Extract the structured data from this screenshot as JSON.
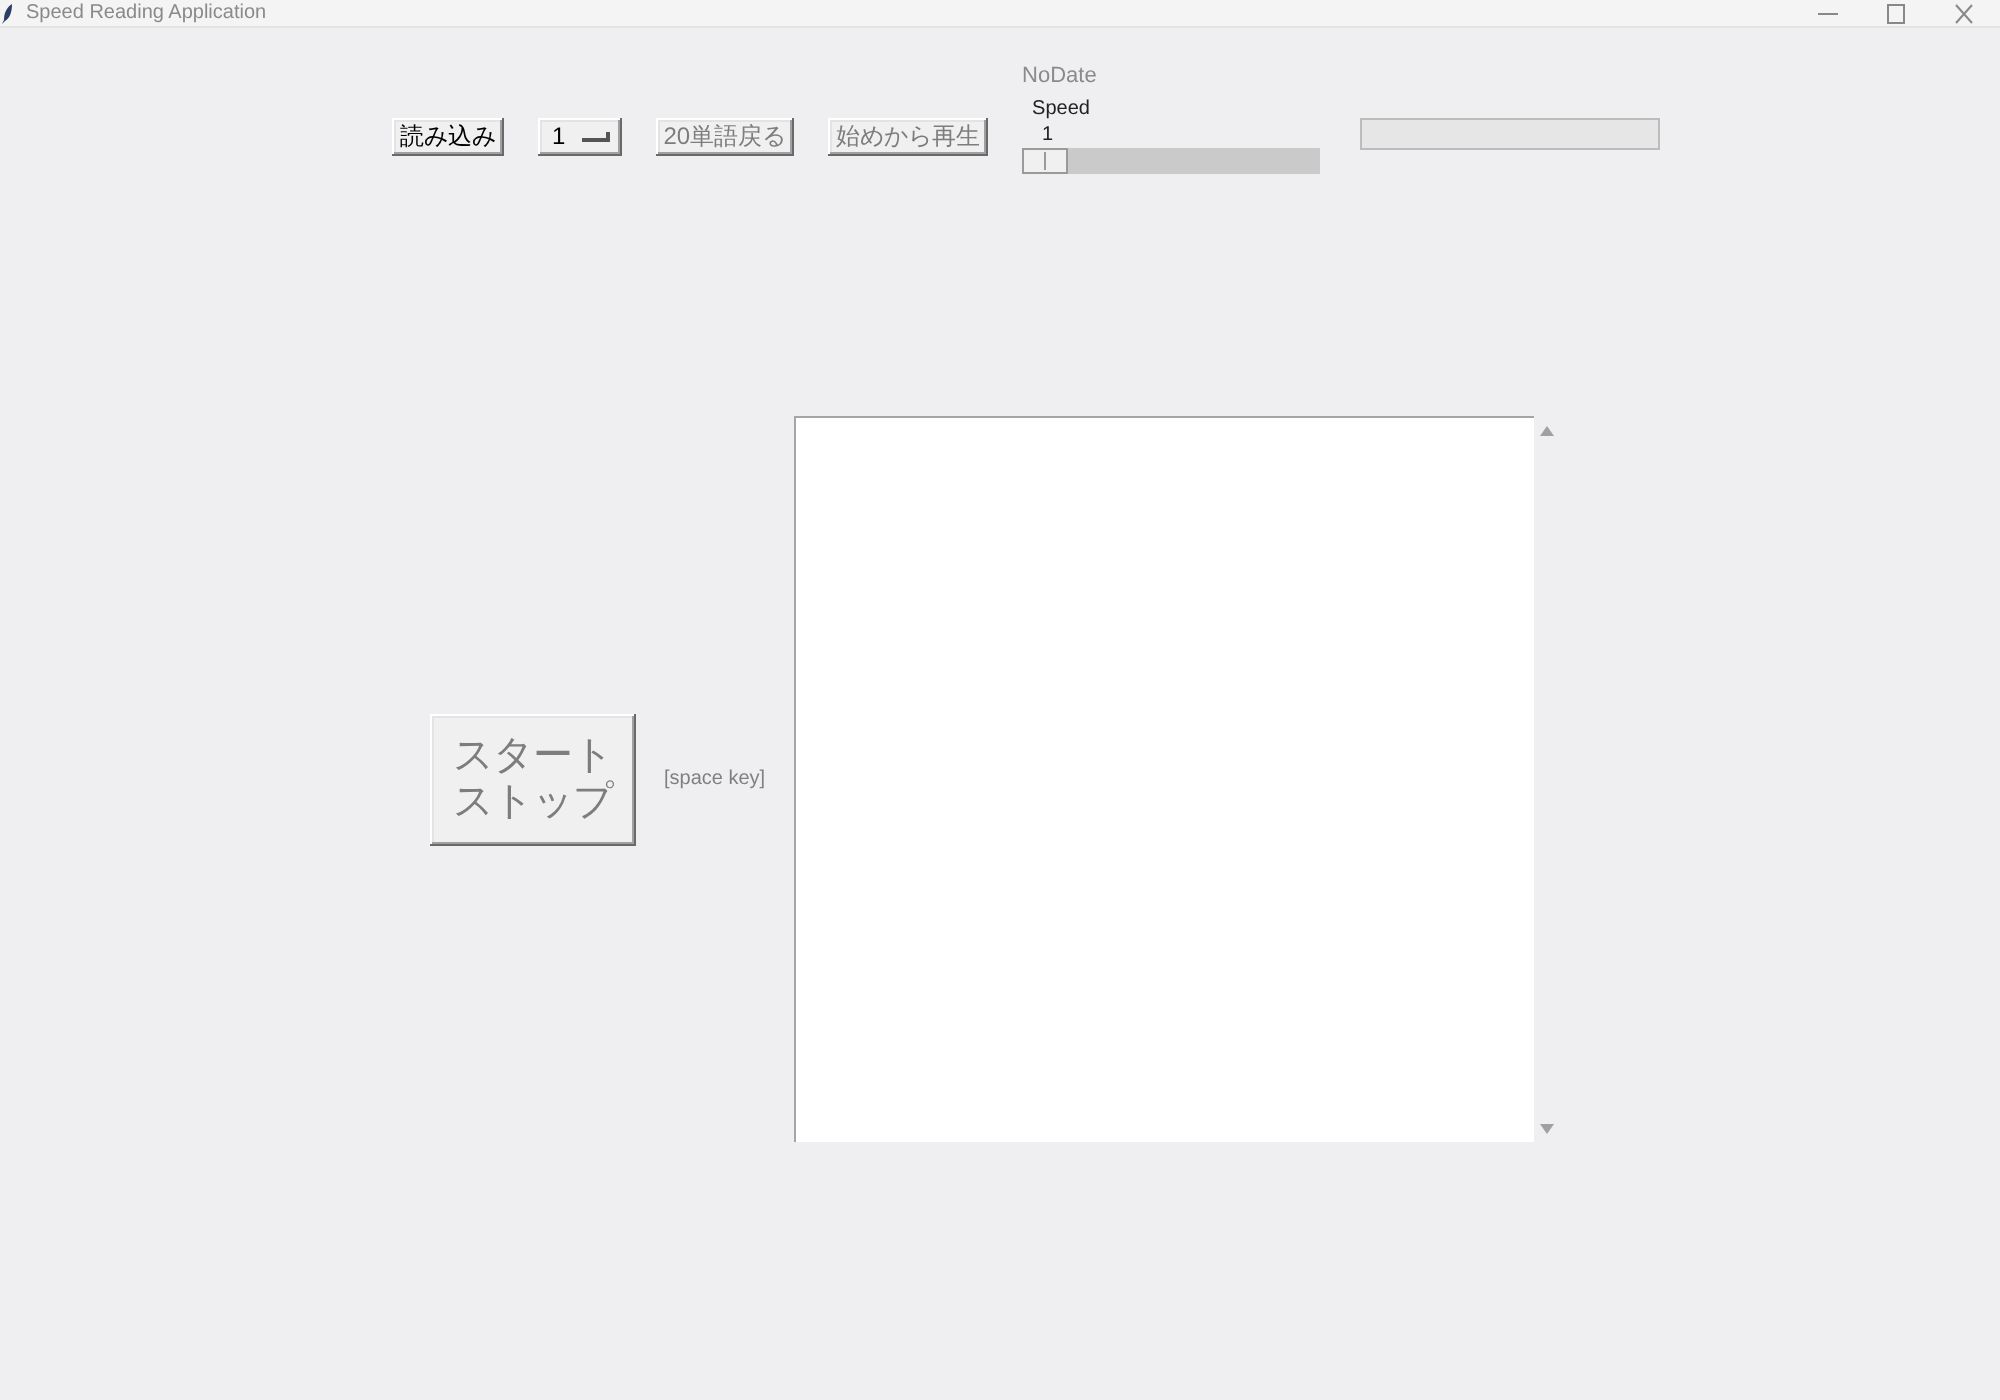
{
  "window": {
    "title": "Speed Reading Application"
  },
  "toolbar": [
    {
      "kind": "button",
      "label": "読み込み",
      "disabled": false
    },
    {
      "kind": "option_menu",
      "value": "1"
    },
    {
      "kind": "button",
      "label": "20単語戻る",
      "disabled": true
    },
    {
      "kind": "button",
      "label": "始めから再生",
      "disabled": true
    }
  ],
  "status": "NoDate",
  "speed": {
    "label": "Speed",
    "reading": "1",
    "level": 0
  },
  "progress": {
    "level": 0
  },
  "start_stop": {
    "label_lines": [
      "スタート",
      "ストップ"
    ],
    "disabled": true
  },
  "hint": "[space key]"
}
